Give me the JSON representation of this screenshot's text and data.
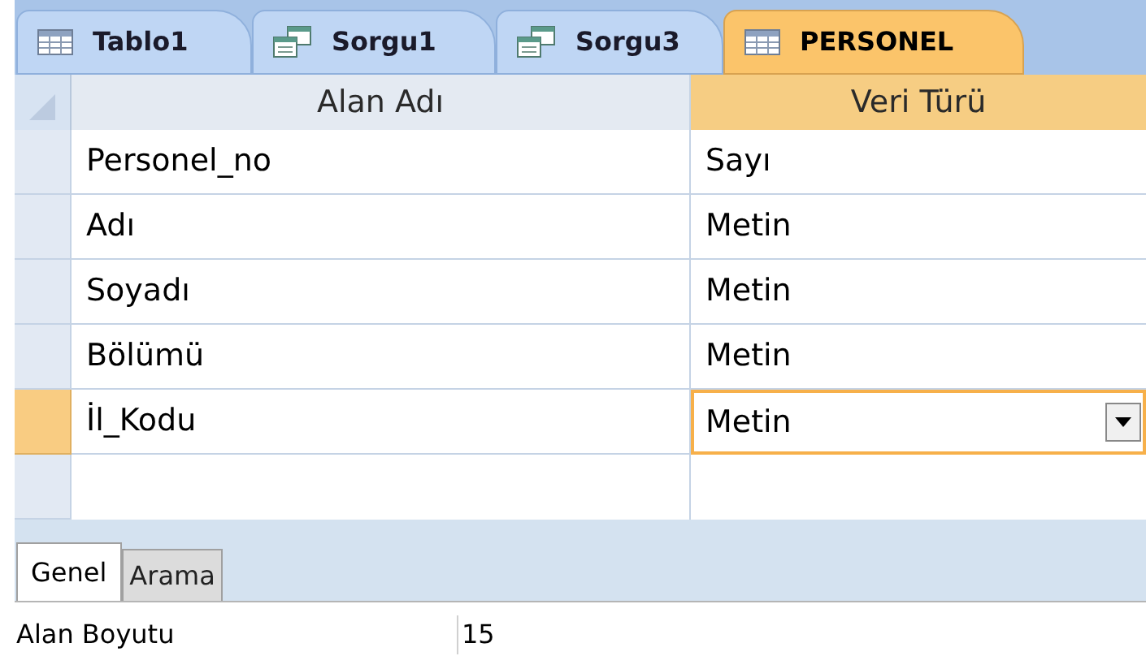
{
  "tabs": [
    {
      "label": "Tablo1",
      "kind": "table",
      "selected": false
    },
    {
      "label": "Sorgu1",
      "kind": "query",
      "selected": false
    },
    {
      "label": "Sorgu3",
      "kind": "query",
      "selected": false
    },
    {
      "label": "PERSONEL",
      "kind": "table",
      "selected": true
    }
  ],
  "table": {
    "columns": [
      "Alan Adı",
      "Veri Türü"
    ],
    "rows": [
      {
        "field": "Personel_no",
        "type": "Sayı",
        "selected": false
      },
      {
        "field": "Adı",
        "type": "Metin",
        "selected": false
      },
      {
        "field": "Soyadı",
        "type": "Metin",
        "selected": false
      },
      {
        "field": "Bölümü",
        "type": "Metin",
        "selected": false
      },
      {
        "field": "İl_Kodu",
        "type": "Metin",
        "selected": true
      }
    ]
  },
  "property_tabs": [
    {
      "label": "Genel",
      "selected": true
    },
    {
      "label": "Arama",
      "selected": false
    }
  ],
  "properties": [
    {
      "label": "Alan Boyutu",
      "value": "15"
    }
  ]
}
